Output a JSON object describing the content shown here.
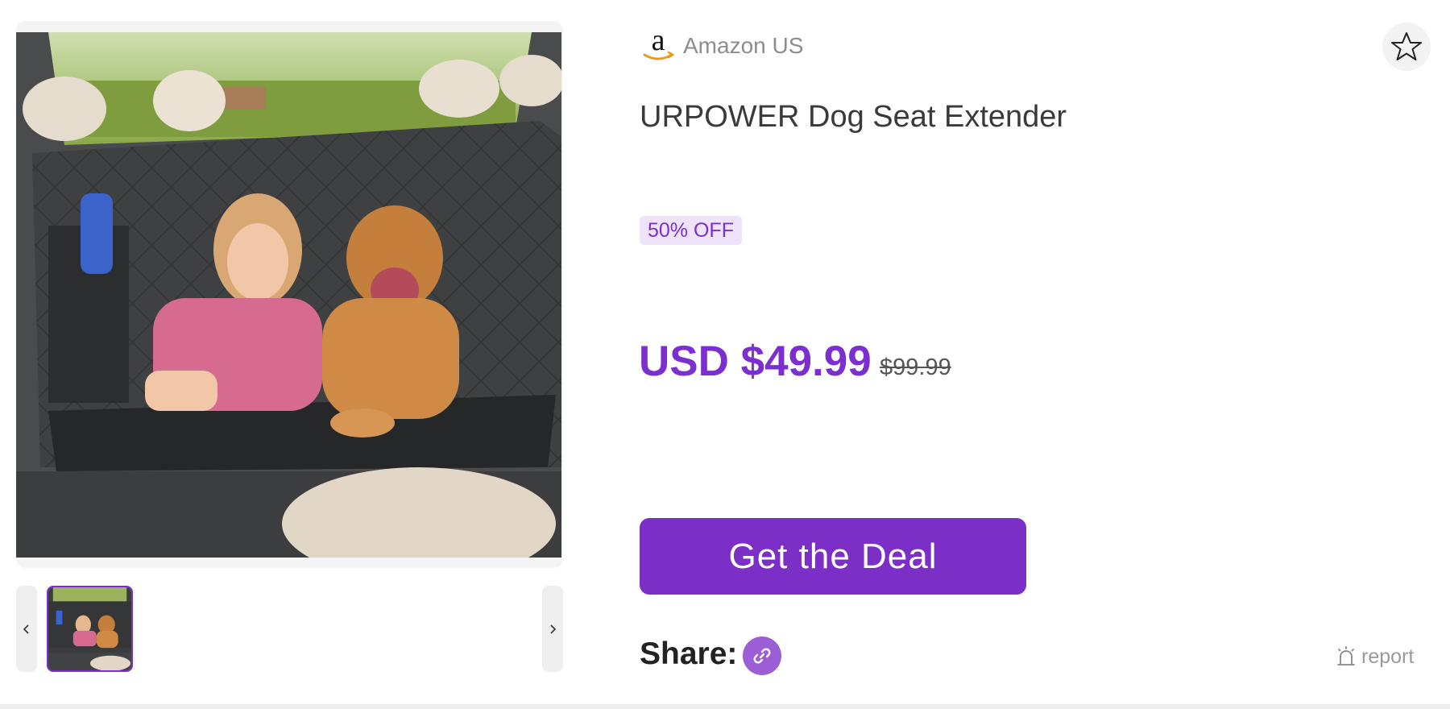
{
  "merchant": {
    "name": "Amazon US",
    "logo_icon": "amazon-logo-icon"
  },
  "product": {
    "title": "URPOWER Dog Seat Extender",
    "image_description_icon": "product-photo"
  },
  "discount": {
    "label": "50% OFF"
  },
  "pricing": {
    "price": "USD $49.99",
    "original_price": "$99.99"
  },
  "actions": {
    "deal_button_label": "Get the Deal",
    "favorite_icon": "star-icon"
  },
  "share": {
    "label": "Share:",
    "link_icon": "link-icon"
  },
  "report": {
    "label": "report",
    "icon": "alarm-icon"
  },
  "gallery": {
    "prev_icon": "chevron-left-icon",
    "next_icon": "chevron-right-icon",
    "thumbnail_count": 1,
    "selected_index": 0
  },
  "colors": {
    "accent": "#7b2fc6",
    "badge_bg": "#efe3fb",
    "share_button": "#9b5ed4"
  }
}
